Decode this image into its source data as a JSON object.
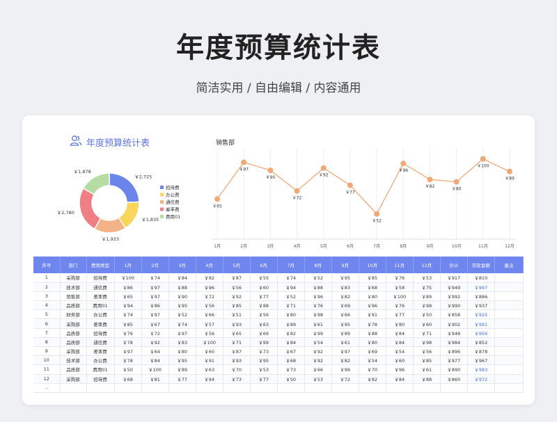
{
  "header": {
    "title": "年度预算统计表",
    "subtitle": "简洁实用 / 自由编辑 / 内容通用"
  },
  "panel": {
    "title": "年度预算统计表",
    "icon": "users-icon"
  },
  "chart_data": [
    {
      "type": "pie",
      "categories": [
        "招待费",
        "办公费",
        "通信费",
        "差率费",
        "费用01"
      ],
      "values": [
        2725,
        1835,
        1933,
        2780,
        1878
      ],
      "data_labels": [
        "￥2,725",
        "￥1,835",
        "￥1,933",
        "￥2,780",
        "￥1,878"
      ],
      "colors": [
        "#6b85ec",
        "#f9d55c",
        "#f3b386",
        "#f07f85",
        "#b5dca3"
      ],
      "legend": "right"
    },
    {
      "type": "line",
      "title": "销售部",
      "categories": [
        "1月",
        "2月",
        "3月",
        "4月",
        "5月",
        "6月",
        "7月",
        "8月",
        "9月",
        "10月",
        "11月",
        "12月"
      ],
      "values": [
        65,
        97,
        90,
        72,
        92,
        77,
        52,
        96,
        82,
        80,
        100,
        89
      ],
      "data_labels": [
        "￥65",
        "￥97",
        "￥90",
        "￥72",
        "￥92",
        "￥77",
        "￥52",
        "￥96",
        "￥82",
        "￥80",
        "￥100",
        "￥89"
      ],
      "color": "#f0a877",
      "ylim": [
        30,
        110
      ]
    }
  ],
  "table": {
    "headers": [
      "序号",
      "部门",
      "费用类型",
      "1月",
      "2月",
      "3月",
      "4月",
      "5月",
      "6月",
      "7月",
      "8月",
      "9月",
      "10月",
      "11月",
      "12月",
      "合计",
      "实际金额",
      "备注"
    ],
    "rows": [
      [
        "1",
        "采购部",
        "招待费",
        "￥100",
        "￥74",
        "￥84",
        "￥82",
        "￥87",
        "￥55",
        "￥74",
        "￥52",
        "￥95",
        "￥85",
        "￥76",
        "￥53",
        "￥917",
        "￥810",
        ""
      ],
      [
        "2",
        "技术部",
        "通信费",
        "￥86",
        "￥97",
        "￥88",
        "￥96",
        "￥56",
        "￥60",
        "￥94",
        "￥88",
        "￥83",
        "￥68",
        "￥58",
        "￥75",
        "￥949",
        "￥997",
        ""
      ],
      [
        "3",
        "销售部",
        "差率费",
        "￥65",
        "￥97",
        "￥90",
        "￥72",
        "￥92",
        "￥77",
        "￥52",
        "￥96",
        "￥82",
        "￥80",
        "￥100",
        "￥89",
        "￥992",
        "￥886",
        ""
      ],
      [
        "4",
        "品质部",
        "费用01",
        "￥94",
        "￥86",
        "￥95",
        "￥56",
        "￥85",
        "￥88",
        "￥71",
        "￥76",
        "￥69",
        "￥96",
        "￥76",
        "￥98",
        "￥990",
        "￥937",
        ""
      ],
      [
        "5",
        "财务部",
        "办公费",
        "￥74",
        "￥97",
        "￥52",
        "￥66",
        "￥51",
        "￥56",
        "￥80",
        "￥98",
        "￥66",
        "￥91",
        "￥77",
        "￥50",
        "￥858",
        "￥925",
        ""
      ],
      [
        "6",
        "采购部",
        "差率费",
        "￥85",
        "￥67",
        "￥74",
        "￥57",
        "￥93",
        "￥63",
        "￥89",
        "￥61",
        "￥95",
        "￥78",
        "￥80",
        "￥60",
        "￥902",
        "￥991",
        ""
      ],
      [
        "7",
        "品质部",
        "招待费",
        "￥76",
        "￥72",
        "￥97",
        "￥56",
        "￥65",
        "￥69",
        "￥82",
        "￥99",
        "￥89",
        "￥88",
        "￥84",
        "￥71",
        "￥948",
        "￥956",
        ""
      ],
      [
        "8",
        "品质部",
        "通信费",
        "￥78",
        "￥92",
        "￥83",
        "￥100",
        "￥71",
        "￥99",
        "￥84",
        "￥54",
        "￥61",
        "￥80",
        "￥84",
        "￥98",
        "￥984",
        "￥852",
        ""
      ],
      [
        "9",
        "采购部",
        "差率费",
        "￥97",
        "￥64",
        "￥80",
        "￥60",
        "￥87",
        "￥73",
        "￥67",
        "￥92",
        "￥97",
        "￥69",
        "￥54",
        "￥56",
        "￥896",
        "￥878",
        ""
      ],
      [
        "10",
        "技术部",
        "办公费",
        "￥78",
        "￥84",
        "￥95",
        "￥91",
        "￥93",
        "￥95",
        "￥68",
        "￥92",
        "￥82",
        "￥54",
        "￥60",
        "￥85",
        "￥977",
        "￥967",
        ""
      ],
      [
        "11",
        "品质部",
        "费用01",
        "￥50",
        "￥100",
        "￥89",
        "￥63",
        "￥70",
        "￥53",
        "￥73",
        "￥66",
        "￥99",
        "￥70",
        "￥96",
        "￥61",
        "￥890",
        "￥983",
        ""
      ],
      [
        "12",
        "采购部",
        "招待费",
        "￥68",
        "￥81",
        "￥77",
        "￥94",
        "￥73",
        "￥77",
        "￥50",
        "￥53",
        "￥72",
        "￥82",
        "￥84",
        "￥88",
        "￥860",
        "￥972",
        ""
      ],
      [
        "-",
        "",
        "",
        "",
        "",
        "",
        "",
        "",
        "",
        "",
        "",
        "",
        "",
        "",
        "",
        "",
        "",
        ""
      ]
    ],
    "blue_actual_rows": [
      1,
      4,
      5,
      6,
      10,
      11
    ]
  }
}
